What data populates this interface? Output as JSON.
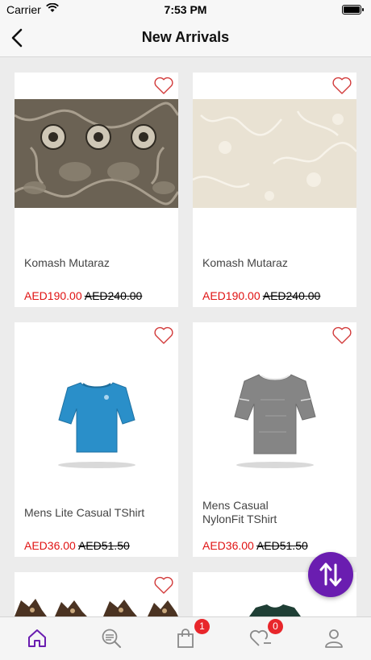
{
  "status_bar": {
    "carrier": "Carrier",
    "time": "7:53 PM"
  },
  "header": {
    "title": "New Arrivals"
  },
  "products": [
    {
      "name": "Komash Mutaraz",
      "price": "AED190.00",
      "old_price": "AED240.00"
    },
    {
      "name": "Komash Mutaraz",
      "price": "AED190.00",
      "old_price": "AED240.00"
    },
    {
      "name": "Mens Lite Casual TShirt",
      "price": "AED36.00",
      "old_price": "AED51.50"
    },
    {
      "name": "Mens Casual NylonFit TShirt",
      "price": "AED36.00",
      "old_price": "AED51.50"
    }
  ],
  "tab_bar": {
    "items": [
      "home-icon",
      "search-list-icon",
      "bag-icon",
      "wishlist-icon",
      "profile-icon"
    ],
    "cart_badge": "1",
    "wishlist_badge": "0",
    "active_color": "#6a1db0"
  },
  "colors": {
    "accent": "#6a1db0",
    "sale_price": "#e01212",
    "heart": "#d23a3a"
  }
}
